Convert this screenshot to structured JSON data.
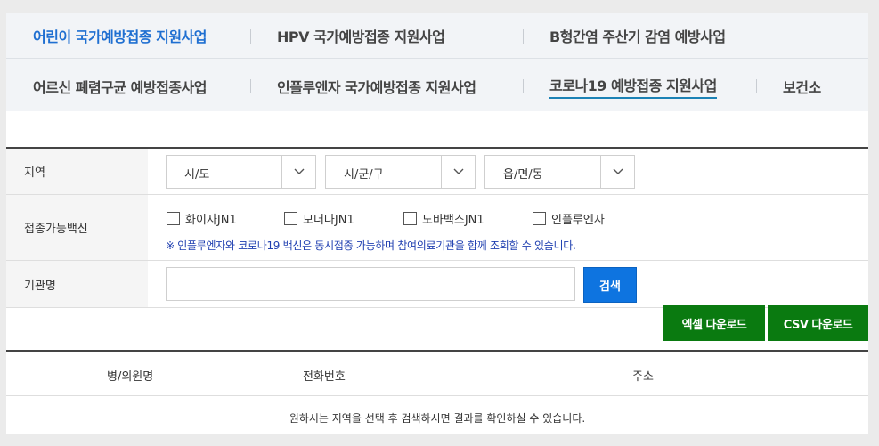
{
  "tabs": {
    "row1": [
      {
        "label": "어린이 국가예방접종 지원사업",
        "state": "blue"
      },
      {
        "label": "HPV 국가예방접종 지원사업",
        "state": "normal"
      },
      {
        "label": "B형간염 주산기 감염 예방사업",
        "state": "normal"
      }
    ],
    "row2": [
      {
        "label": "어르신 폐렴구균 예방접종사업",
        "state": "normal"
      },
      {
        "label": "인플루엔자 국가예방접종 지원사업",
        "state": "normal"
      },
      {
        "label": "코로나19 예방접종 지원사업",
        "state": "current"
      },
      {
        "label": "보건소",
        "state": "normal"
      }
    ]
  },
  "form": {
    "region_label": "지역",
    "selects": [
      "시/도",
      "시/군/구",
      "읍/면/동"
    ],
    "vaccine_label": "접종가능백신",
    "vaccines": [
      "화이자JN1",
      "모더나JN1",
      "노바백스JN1",
      "인플루엔자"
    ],
    "notice": "※ 인플루엔자와 코로나19 백신은 동시접종 가능하며 참여의료기관을 함께 조회할 수 있습니다.",
    "institution_label": "기관명",
    "institution_value": "",
    "search_label": "검색"
  },
  "downloads": {
    "excel": "엑셀 다운로드",
    "csv": "CSV 다운로드"
  },
  "results": {
    "columns": [
      "병/의원명",
      "전화번호",
      "주소"
    ],
    "empty_message": "원하시는 지역을 선택 후 검색하시면 결과를 확인하실 수 있습니다."
  },
  "colors": {
    "primary_blue": "#0e74e0",
    "download_green": "#0a7a10",
    "tab_active": "#1f6fd1"
  }
}
